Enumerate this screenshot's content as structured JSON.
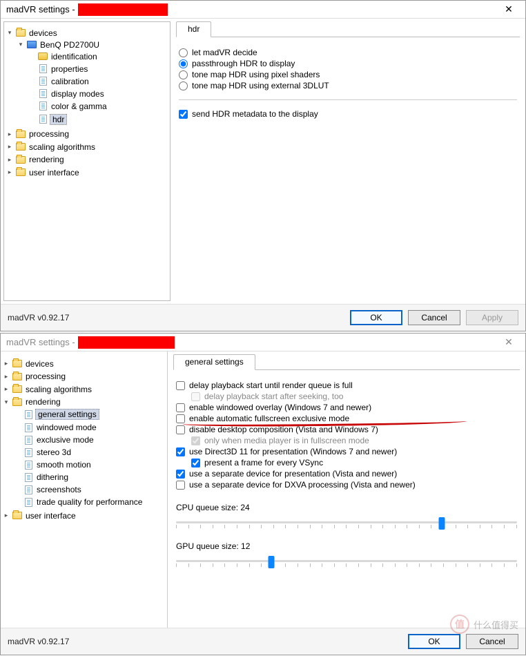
{
  "top": {
    "title_prefix": "madVR settings - ",
    "close": "✕",
    "tree": {
      "devices": "devices",
      "device_name": "BenQ PD2700U",
      "identification": "identification",
      "properties": "properties",
      "calibration": "calibration",
      "display_modes": "display modes",
      "color_gamma": "color & gamma",
      "hdr": "hdr",
      "processing": "processing",
      "scaling": "scaling algorithms",
      "rendering": "rendering",
      "ui": "user interface"
    },
    "tab": "hdr",
    "radios": {
      "r1": "let madVR decide",
      "r2": "passthrough HDR to display",
      "r3": "tone map HDR using pixel shaders",
      "r4": "tone map HDR using external 3DLUT"
    },
    "chk_metadata": "send HDR metadata to the display",
    "version": "madVR v0.92.17",
    "btn_ok": "OK",
    "btn_cancel": "Cancel",
    "btn_apply": "Apply"
  },
  "bottom": {
    "title_prefix": "madVR settings - ",
    "close": "✕",
    "tree": {
      "devices": "devices",
      "processing": "processing",
      "scaling": "scaling algorithms",
      "rendering": "rendering",
      "general_settings": "general settings",
      "windowed_mode": "windowed mode",
      "exclusive_mode": "exclusive mode",
      "stereo_3d": "stereo 3d",
      "smooth_motion": "smooth motion",
      "dithering": "dithering",
      "screenshots": "screenshots",
      "trade_quality": "trade quality for performance",
      "ui": "user interface"
    },
    "tab": "general settings",
    "opts": {
      "delay_start": "delay playback start until render queue is full",
      "delay_seek": "delay playback start after seeking, too",
      "enable_overlay": "enable windowed overlay (Windows 7 and newer)",
      "enable_fse": "enable automatic fullscreen exclusive mode",
      "disable_dwm": "disable desktop composition (Vista and Windows 7)",
      "only_fullscreen": "only when media player is in fullscreen mode",
      "use_d3d11": "use Direct3D 11 for presentation (Windows 7 and newer)",
      "present_vsync": "present a frame for every VSync",
      "sep_present": "use a separate device for presentation (Vista and newer)",
      "sep_dxva": "use a separate device for DXVA processing (Vista and newer)"
    },
    "cpu_label": "CPU queue size: 24",
    "cpu_value_pct": 78,
    "gpu_label": "GPU queue size: 12",
    "gpu_value_pct": 28,
    "version": "madVR v0.92.17",
    "btn_ok": "OK",
    "btn_cancel": "Cancel",
    "watermark": "什么值得买"
  }
}
